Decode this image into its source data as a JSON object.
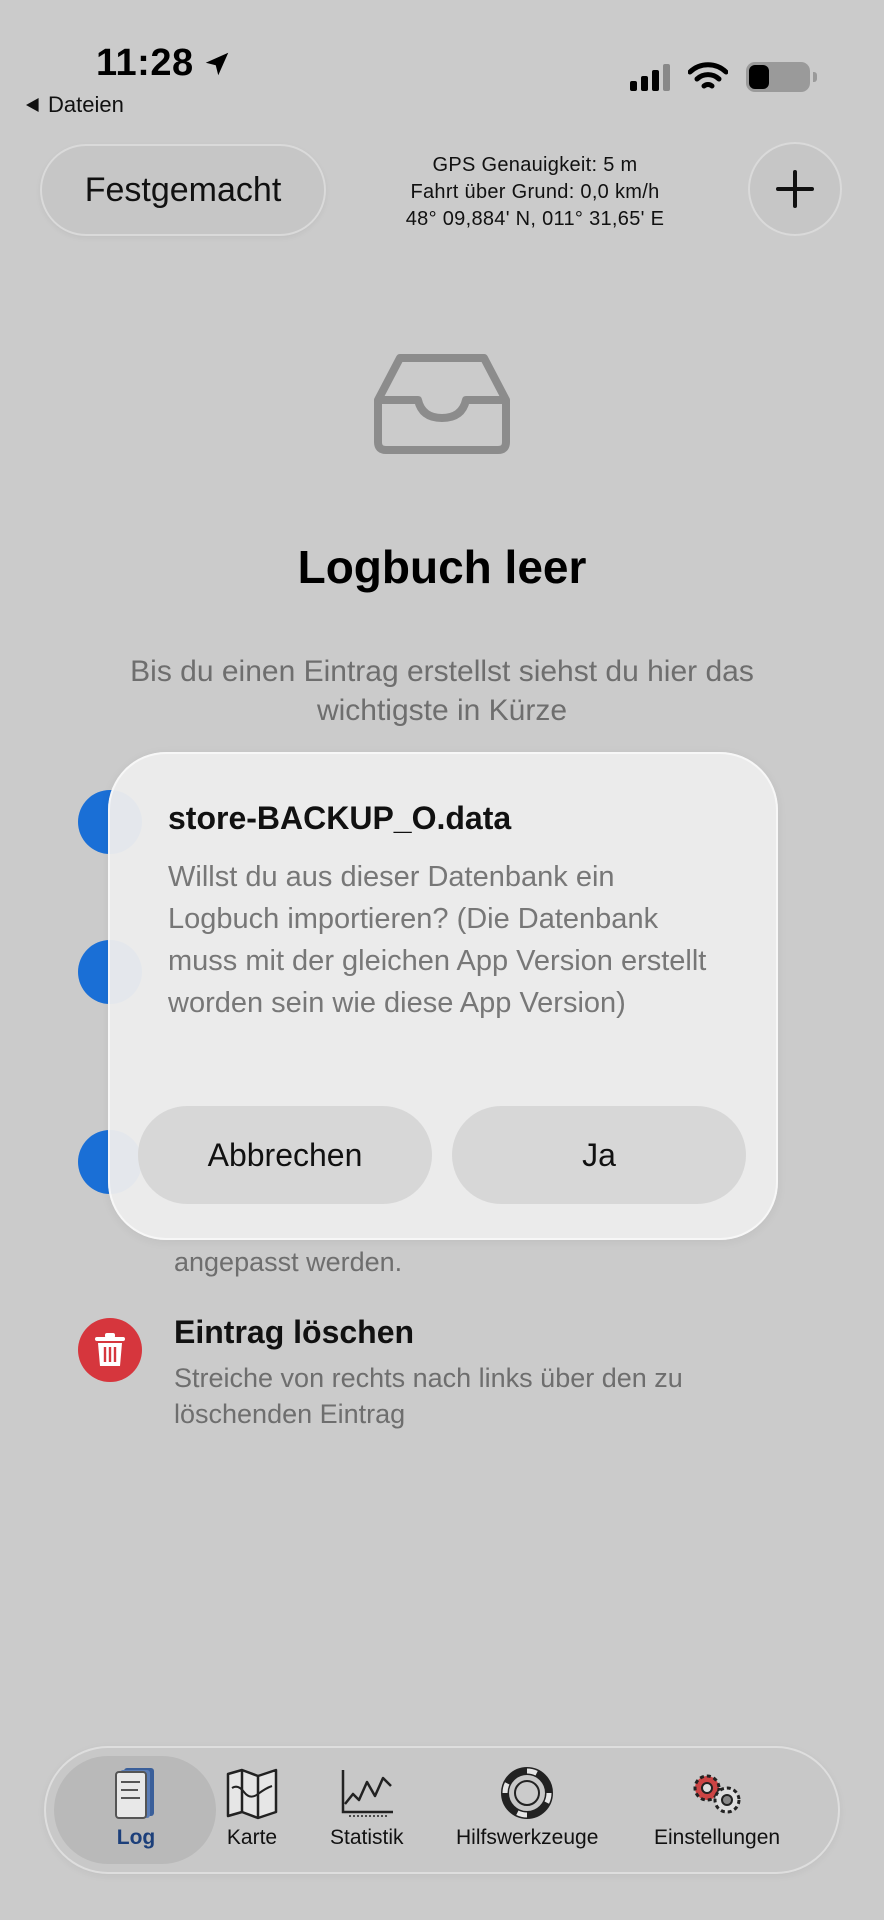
{
  "status_bar": {
    "time": "11:28",
    "back_label": "Dateien"
  },
  "header": {
    "mode_button": "Festgemacht",
    "gps_accuracy": "GPS Genauigkeit: 5 m",
    "speed_over_ground": "Fahrt über Grund: 0,0 km/h",
    "position": "48° 09,884' N, 011° 31,65' E"
  },
  "empty_state": {
    "icon": "tray-icon",
    "title": "Logbuch leer",
    "description": "Bis du einen Eintrag erstellst siehst du hier das wichtigste in Kürze"
  },
  "tips": [
    {
      "icon": "blue-circle-icon",
      "title": "",
      "text": ""
    },
    {
      "icon": "blue-play-icon",
      "title": "",
      "text": ""
    },
    {
      "icon": "blue-minus-icon",
      "title": "",
      "text": "angepasst werden."
    },
    {
      "icon": "trash-icon",
      "title": "Eintrag löschen",
      "text": "Streiche von rechts nach links über den zu löschenden Eintrag"
    }
  ],
  "alert": {
    "title": "store-BACKUP_O.data",
    "message": "Willst du aus dieser Datenbank ein Logbuch importieren? (Die Datenbank muss mit der gleichen App Version erstellt worden sein wie diese App Version)",
    "cancel_label": "Abbrechen",
    "confirm_label": "Ja"
  },
  "tabbar": {
    "active": "Log",
    "items": [
      {
        "label": "Log",
        "icon": "logbook-icon"
      },
      {
        "label": "Karte",
        "icon": "map-icon"
      },
      {
        "label": "Statistik",
        "icon": "chart-icon"
      },
      {
        "label": "Hilfswerkzeuge",
        "icon": "lifebuoy-icon"
      },
      {
        "label": "Einstellungen",
        "icon": "gears-icon"
      }
    ]
  },
  "colors": {
    "background": "#cbcbcb",
    "accent_blue": "#1a6fd6",
    "delete_red": "#d6363d",
    "active_tab_text": "#1c3f7a"
  }
}
